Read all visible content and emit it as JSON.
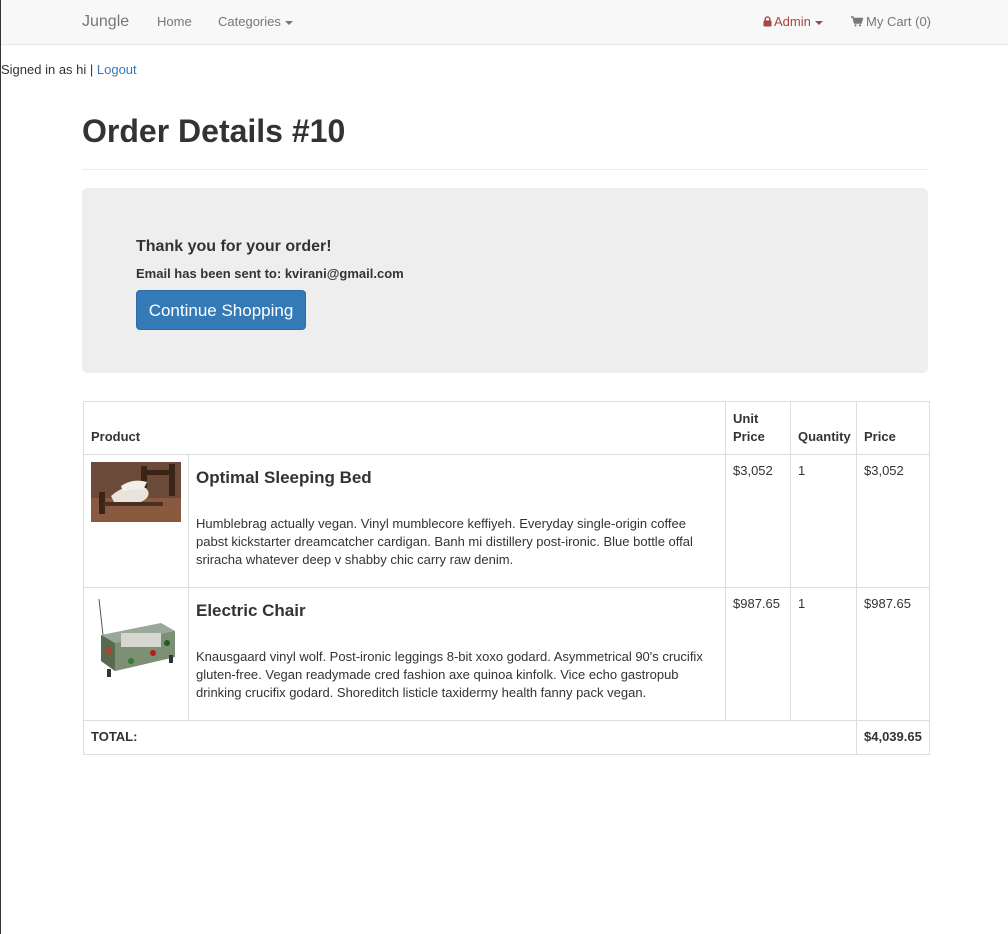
{
  "navbar": {
    "brand": "Jungle",
    "home": "Home",
    "categories": "Categories",
    "admin": "Admin",
    "cart": "My Cart (0)"
  },
  "session": {
    "signed_in_text": "Signed in as hi | ",
    "logout": "Logout"
  },
  "page": {
    "title": "Order Details #10"
  },
  "jumbotron": {
    "thanks": "Thank you for your order!",
    "email_line": "Email has been sent to: kvirani@gmail.com",
    "continue_button": "Continue Shopping"
  },
  "table": {
    "headers": {
      "product": "Product",
      "unit_price": "Unit Price",
      "quantity": "Quantity",
      "price": "Price"
    },
    "rows": [
      {
        "name": "Optimal Sleeping Bed",
        "description": "Humblebrag actually vegan. Vinyl mumblecore keffiyeh. Everyday single-origin coffee pabst kickstarter dreamcatcher cardigan. Banh mi distillery post-ironic. Blue bottle offal sriracha whatever deep v shabby chic carry raw denim.",
        "unit_price": "$3,052",
        "quantity": "1",
        "price": "$3,052"
      },
      {
        "name": "Electric Chair",
        "description": "Knausgaard vinyl wolf. Post-ironic leggings 8-bit xoxo godard. Asymmetrical 90's crucifix gluten-free. Vegan readymade cred fashion axe quinoa kinfolk. Vice echo gastropub drinking crucifix godard. Shoreditch listicle taxidermy health fanny pack vegan.",
        "unit_price": "$987.65",
        "quantity": "1",
        "price": "$987.65"
      }
    ],
    "total_label": "TOTAL:",
    "total_value": "$4,039.65"
  },
  "colors": {
    "link": "#337ab7",
    "admin": "#a94442",
    "button": "#337ab7",
    "jumbotron_bg": "#eeeeee"
  }
}
